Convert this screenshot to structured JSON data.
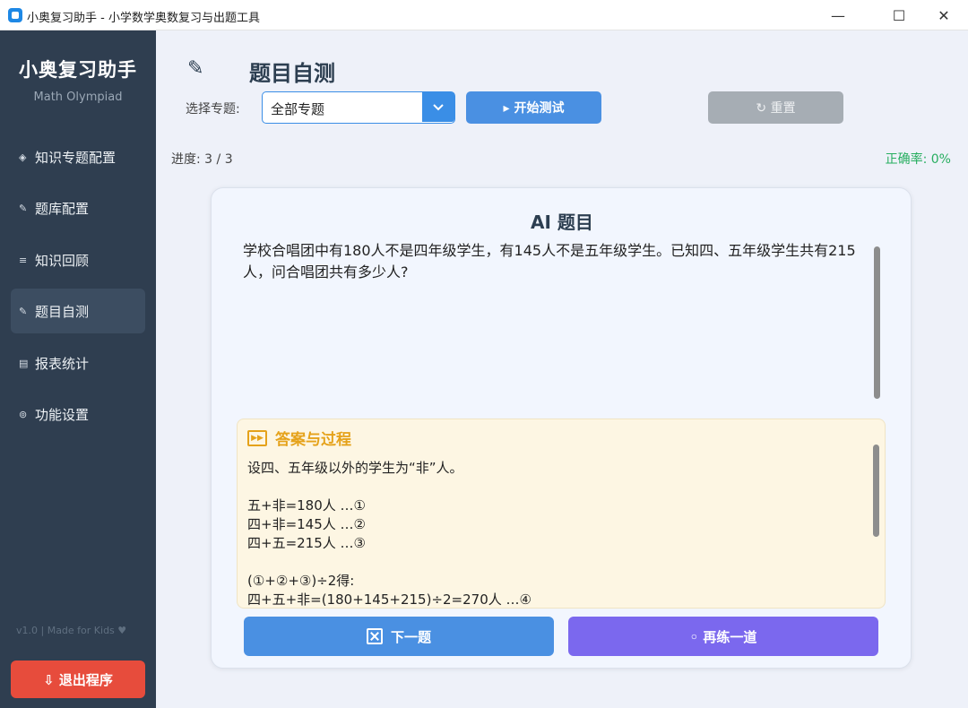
{
  "window": {
    "title": "小奥复习助手 - 小学数学奥数复习与出题工具",
    "minimize": "—",
    "maximize": "☐",
    "close": "✕"
  },
  "sidebar": {
    "brand": "小奥复习助手",
    "subtitle": "Math Olympiad",
    "items": [
      {
        "icon": "◈",
        "icon_name": "diamond-icon",
        "label": "知识专题配置",
        "active": false
      },
      {
        "icon": "✎",
        "icon_name": "pencil-icon",
        "label": "题库配置",
        "active": false
      },
      {
        "icon": "≡",
        "icon_name": "list-icon",
        "label": "知识回顾",
        "active": false
      },
      {
        "icon": "✎",
        "icon_name": "pencil-icon",
        "label": "题目自测",
        "active": true
      },
      {
        "icon": "▤",
        "icon_name": "report-icon",
        "label": "报表统计",
        "active": false
      },
      {
        "icon": "⊚",
        "icon_name": "gear-icon",
        "label": "功能设置",
        "active": false
      }
    ],
    "version": "v1.0 | Made for Kids ♥",
    "exit_label": "⇩ 退出程序"
  },
  "header": {
    "icon": "✎",
    "title": "题目自测"
  },
  "toolbar": {
    "topic_label": "选择专题:",
    "topic_value": "全部专题",
    "start_label": "▸ 开始测试",
    "reset_label": "↻ 重置"
  },
  "status": {
    "progress": "进度: 3 / 3",
    "accuracy": "正确率: 0%"
  },
  "card": {
    "title": "AI 题目",
    "question": "学校合唱团中有180人不是四年级学生，有145人不是五年级学生。已知四、五年级学生共有215人，问合唱团共有多少人?",
    "answer_title": "答案与过程",
    "answer_body": "设四、五年级以外的学生为“非”人。\n\n五+非=180人  …①\n四+非=145人  …②\n四+五=215人  …③\n\n(①+②+③)÷2得:\n四+五+非=(180+145+215)÷2=270人  …④",
    "next_label": "下一题",
    "again_label": "◦ 再练一道"
  },
  "colors": {
    "sidebar_bg": "#2f3e50",
    "primary": "#4a90e2",
    "purple": "#7b68ee",
    "danger": "#e74c3c",
    "success": "#27ae60",
    "answer_accent": "#e5a21a"
  }
}
